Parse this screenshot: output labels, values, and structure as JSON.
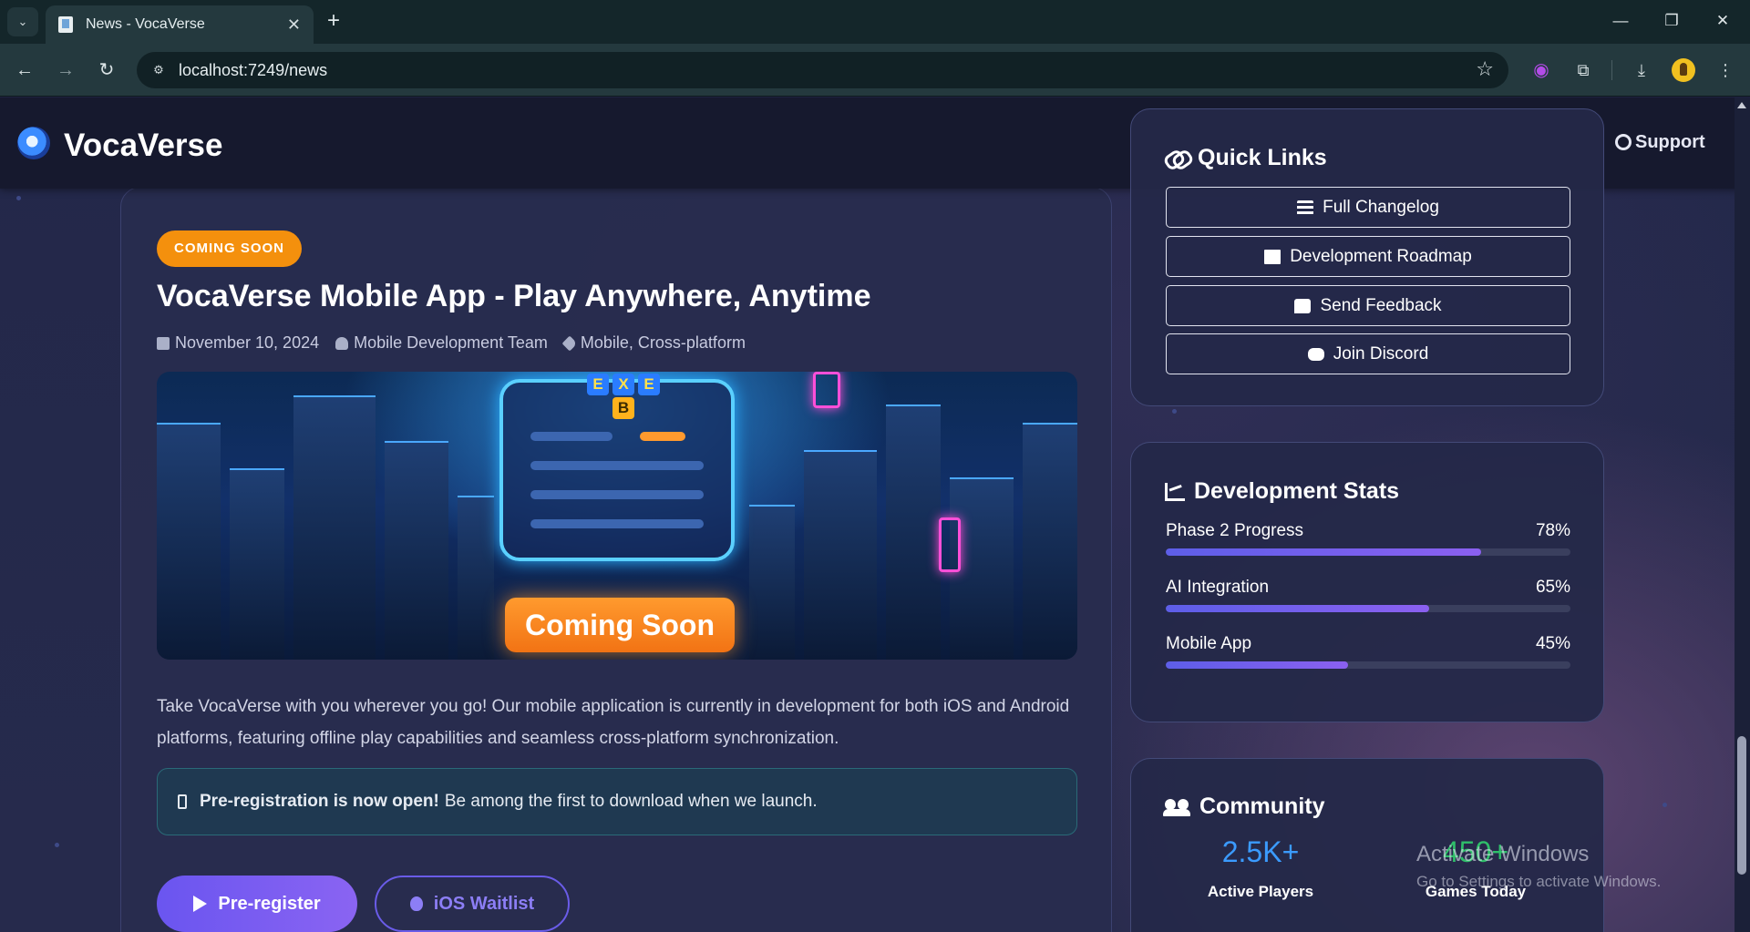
{
  "browser": {
    "tab_title": "News - VocaVerse",
    "url": "localhost:7249/news",
    "minimize": "—",
    "restore": "❐",
    "close": "✕",
    "new_tab": "+",
    "tab_close": "✕"
  },
  "header": {
    "brand": "VocaVerse",
    "support": "Support"
  },
  "article": {
    "badge": "COMING SOON",
    "title": "VocaVerse Mobile App - Play Anywhere, Anytime",
    "date": "November 10, 2024",
    "author": "Mobile Development Team",
    "tags": "Mobile, Cross-platform",
    "hero_caption": "Coming Soon",
    "hero_tiles": [
      "E",
      "X",
      "E",
      "B"
    ],
    "body": "Take VocaVerse with you wherever you go! Our mobile application is currently in development for both iOS and Android platforms, featuring offline play capabilities and seamless cross-platform synchronization.",
    "notice_bold": "Pre-registration is now open!",
    "notice_rest": "Be among the first to download when we launch.",
    "primary_button": "Pre-register",
    "secondary_button": "iOS Waitlist"
  },
  "quick_links": {
    "title": "Quick Links",
    "items": [
      {
        "label": "Full Changelog",
        "icon": "list-icon"
      },
      {
        "label": "Development Roadmap",
        "icon": "map-icon"
      },
      {
        "label": "Send Feedback",
        "icon": "comment-icon"
      },
      {
        "label": "Join Discord",
        "icon": "discord-icon"
      }
    ]
  },
  "dev_stats": {
    "title": "Development Stats",
    "items": [
      {
        "label": "Phase 2 Progress",
        "value": "78%",
        "progress": 0.78
      },
      {
        "label": "AI Integration",
        "value": "65%",
        "progress": 0.65
      },
      {
        "label": "Mobile App",
        "value": "45%",
        "progress": 0.45
      }
    ]
  },
  "community": {
    "title": "Community",
    "stats": [
      {
        "value": "2.5K+",
        "label": "Active Players"
      },
      {
        "value": "450+",
        "label": "Games Today"
      }
    ]
  },
  "watermark": {
    "title": "Activate Windows",
    "subtitle": "Go to Settings to activate Windows."
  },
  "colors": {
    "accent": "#6a55f0",
    "badge": "#f4900d",
    "players": "#3b9bff",
    "games": "#2fbf6a"
  }
}
